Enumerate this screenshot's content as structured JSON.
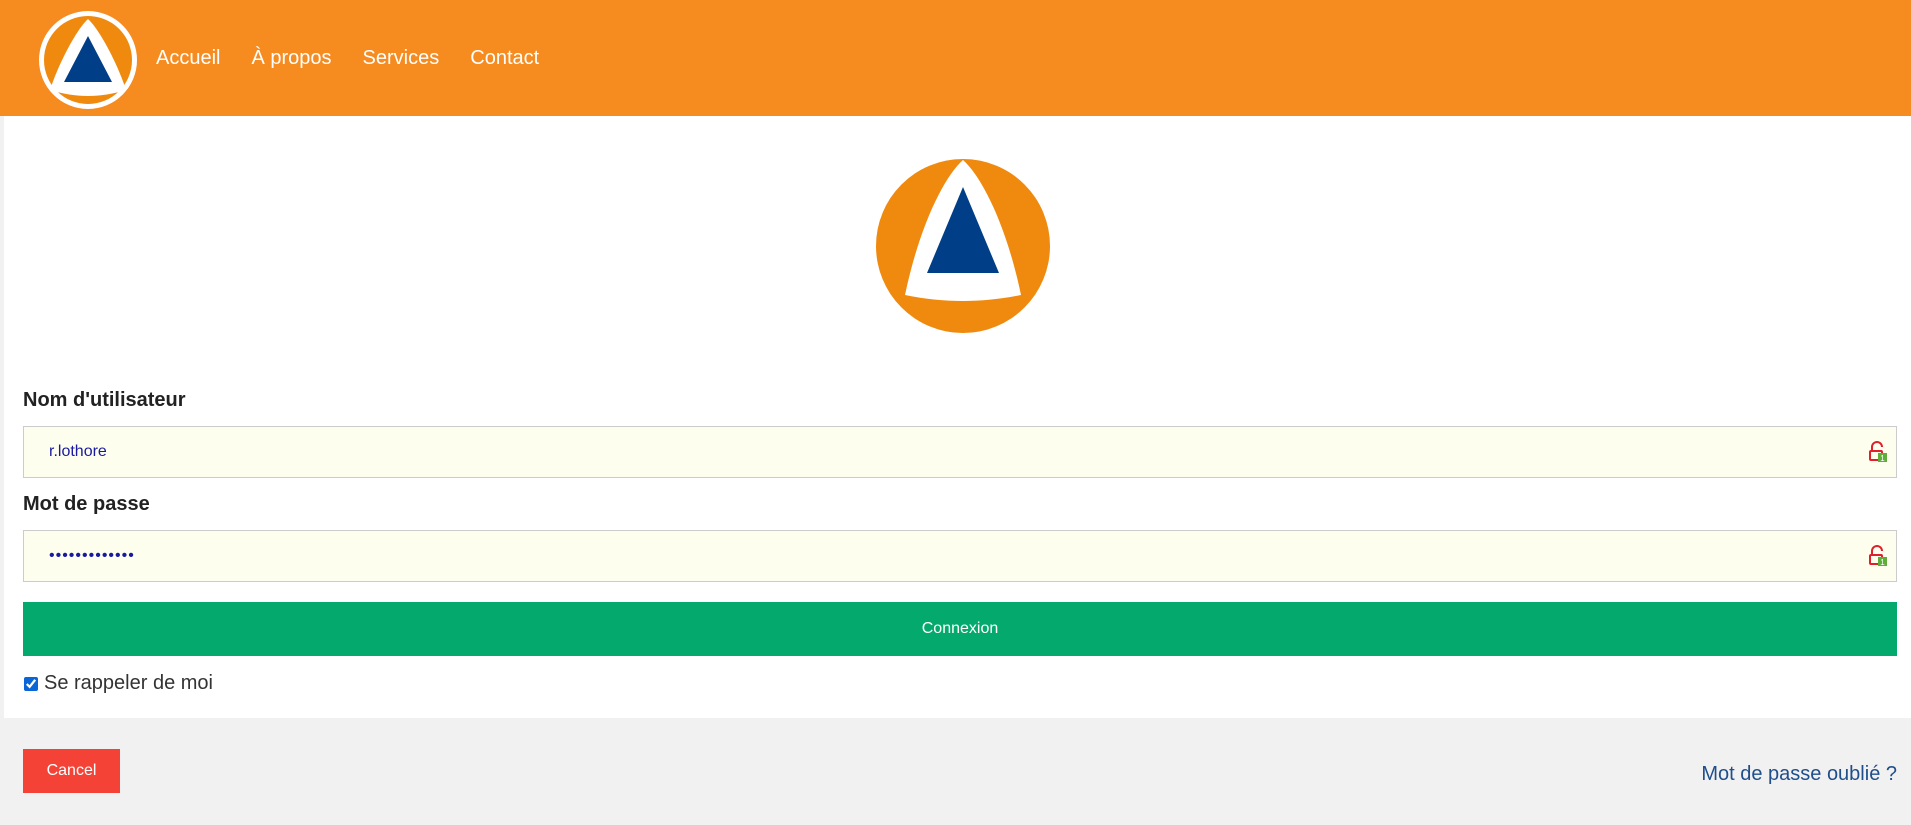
{
  "nav": {
    "items": [
      {
        "label": "Accueil"
      },
      {
        "label": "À propos"
      },
      {
        "label": "Services"
      },
      {
        "label": "Contact"
      }
    ]
  },
  "logo": {
    "icon": "civil-protection-logo-icon",
    "colors": {
      "orange": "#ef8a0f",
      "white": "#ffffff",
      "blue": "#003f87"
    }
  },
  "form": {
    "username_label": "Nom d'utilisateur",
    "username_value": "r.lothore",
    "password_label": "Mot de passe",
    "password_value": "•••••••••••••",
    "login_button": "Connexion",
    "remember_label": "Se rappeler de moi",
    "remember_checked": true
  },
  "footer": {
    "cancel_button": "Cancel",
    "forgot_link": "Mot de passe oublié ?"
  },
  "colors": {
    "header": "#f68b1f",
    "login_button": "#04aa6d",
    "cancel_button": "#f44336",
    "link": "#1f4e8c"
  }
}
